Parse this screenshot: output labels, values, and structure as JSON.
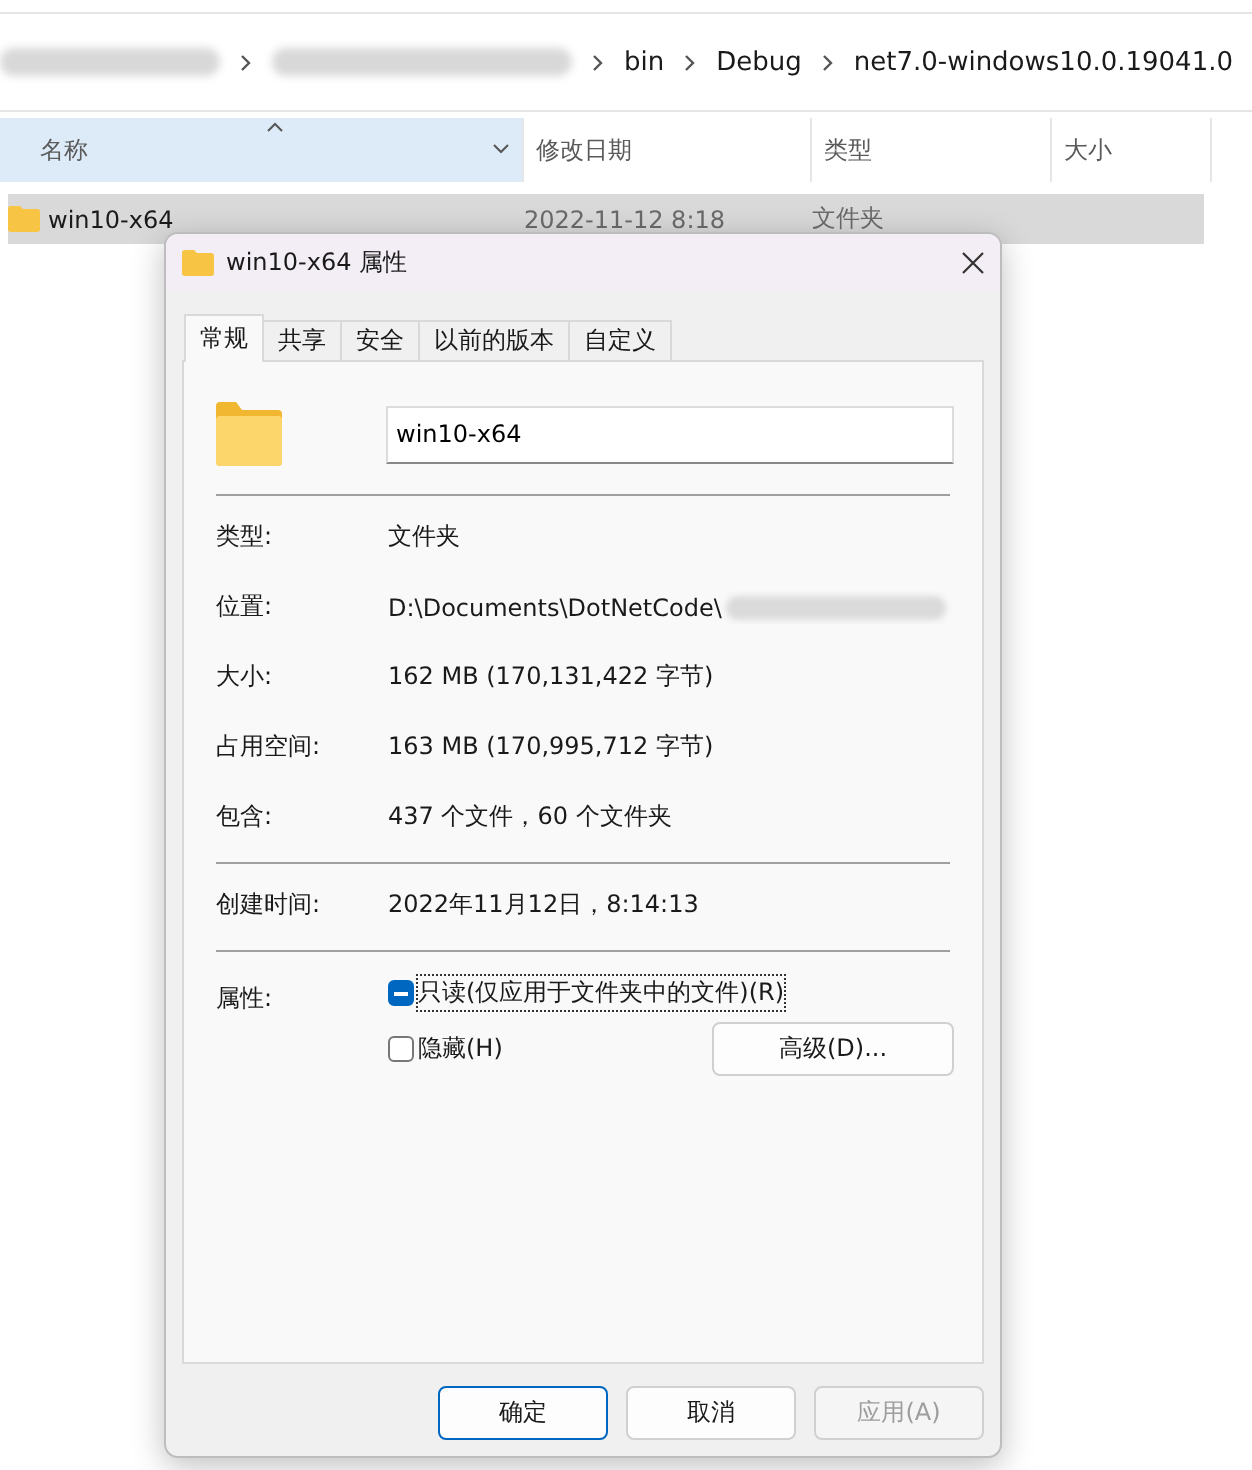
{
  "explorer": {
    "breadcrumb": [
      "bin",
      "Debug",
      "net7.0-windows10.0.19041.0"
    ],
    "columns": [
      {
        "label": "名称",
        "sorted": true,
        "selected": true
      },
      {
        "label": "修改日期",
        "sorted": false,
        "selected": false
      },
      {
        "label": "类型",
        "sorted": false,
        "selected": false
      },
      {
        "label": "大小",
        "sorted": false,
        "selected": false
      }
    ],
    "rows": [
      {
        "name": "win10-x64",
        "modified": "2022-11-12 8:18",
        "type": "文件夹",
        "selected": true
      }
    ]
  },
  "dialog": {
    "title": "win10-x64 属性",
    "tabs": [
      {
        "label": "常规",
        "selected": true
      },
      {
        "label": "共享",
        "selected": false
      },
      {
        "label": "安全",
        "selected": false
      },
      {
        "label": "以前的版本",
        "selected": false
      },
      {
        "label": "自定义",
        "selected": false
      }
    ],
    "name_field": "win10-x64",
    "sections": [
      [
        {
          "label": "类型:",
          "value": "文件夹"
        },
        {
          "label": "位置:",
          "value": "D:\\Documents\\DotNetCode\\",
          "redacted": true
        },
        {
          "label": "大小:",
          "value": "162 MB (170,131,422 字节)"
        },
        {
          "label": "占用空间:",
          "value": "163 MB (170,995,712 字节)"
        },
        {
          "label": "包含:",
          "value": "437 个文件，60 个文件夹"
        }
      ],
      [
        {
          "label": "创建时间:",
          "value": "2022年11月12日，8:14:13"
        }
      ]
    ],
    "attributes_label": "属性:",
    "attributes": [
      {
        "label": "只读(仅应用于文件夹中的文件)(R)",
        "indeterminate": true,
        "focused": true
      },
      {
        "label": "隐藏(H)",
        "indeterminate": false,
        "focused": false
      }
    ],
    "advanced_button": "高级(D)...",
    "buttons": [
      {
        "label": "确定",
        "default": true,
        "disabled": false
      },
      {
        "label": "取消",
        "default": false,
        "disabled": false
      },
      {
        "label": "应用(A)",
        "default": false,
        "disabled": true
      }
    ]
  }
}
